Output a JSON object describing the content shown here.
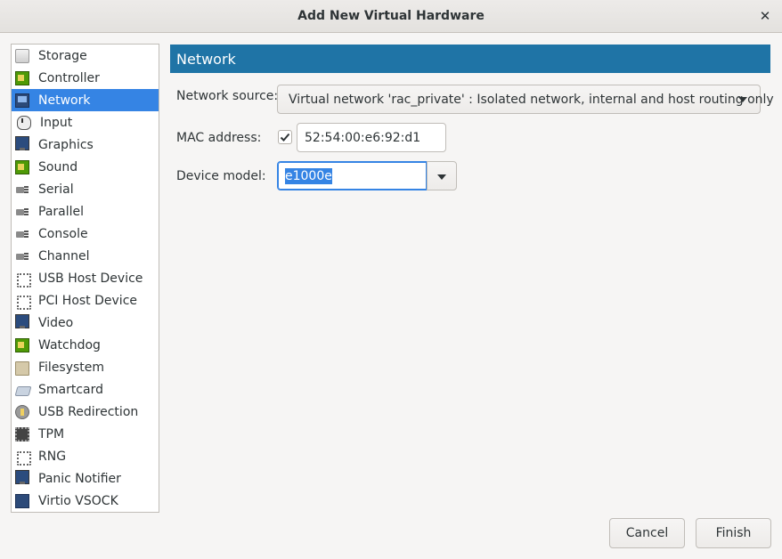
{
  "window": {
    "title": "Add New Virtual Hardware",
    "close_icon": "close-icon"
  },
  "sidebar": {
    "items": [
      {
        "label": "Storage",
        "icon": "disk-icon",
        "selected": false
      },
      {
        "label": "Controller",
        "icon": "card-icon",
        "selected": false
      },
      {
        "label": "Network",
        "icon": "network-icon",
        "selected": true
      },
      {
        "label": "Input",
        "icon": "mouse-icon",
        "selected": false
      },
      {
        "label": "Graphics",
        "icon": "monitor-icon",
        "selected": false
      },
      {
        "label": "Sound",
        "icon": "card-icon",
        "selected": false
      },
      {
        "label": "Serial",
        "icon": "plug-icon",
        "selected": false
      },
      {
        "label": "Parallel",
        "icon": "plug-icon",
        "selected": false
      },
      {
        "label": "Console",
        "icon": "plug-icon",
        "selected": false
      },
      {
        "label": "Channel",
        "icon": "plug-icon",
        "selected": false
      },
      {
        "label": "USB Host Device",
        "icon": "usb-icon",
        "selected": false
      },
      {
        "label": "PCI Host Device",
        "icon": "usb-icon",
        "selected": false
      },
      {
        "label": "Video",
        "icon": "monitor-icon",
        "selected": false
      },
      {
        "label": "Watchdog",
        "icon": "card-icon",
        "selected": false
      },
      {
        "label": "Filesystem",
        "icon": "folder-icon",
        "selected": false
      },
      {
        "label": "Smartcard",
        "icon": "smartcard-icon",
        "selected": false
      },
      {
        "label": "USB Redirection",
        "icon": "usb-redirection-icon",
        "selected": false
      },
      {
        "label": "TPM",
        "icon": "chip-icon",
        "selected": false
      },
      {
        "label": "RNG",
        "icon": "usb-icon",
        "selected": false
      },
      {
        "label": "Panic Notifier",
        "icon": "monitor-icon",
        "selected": false
      },
      {
        "label": "Virtio VSOCK",
        "icon": "network-icon",
        "selected": false
      }
    ]
  },
  "panel": {
    "header": "Network",
    "network_source_label": "Network source:",
    "network_source_value": "Virtual network 'rac_private' : Isolated network, internal and host routing only",
    "mac_label": "MAC address:",
    "mac_checked": true,
    "mac_value": "52:54:00:e6:92:d1",
    "device_model_label": "Device model:",
    "device_model_value": "e1000e"
  },
  "buttons": {
    "cancel": "Cancel",
    "finish": "Finish"
  },
  "colors": {
    "accent": "#3584e4",
    "header_bg": "#1f74a6"
  }
}
